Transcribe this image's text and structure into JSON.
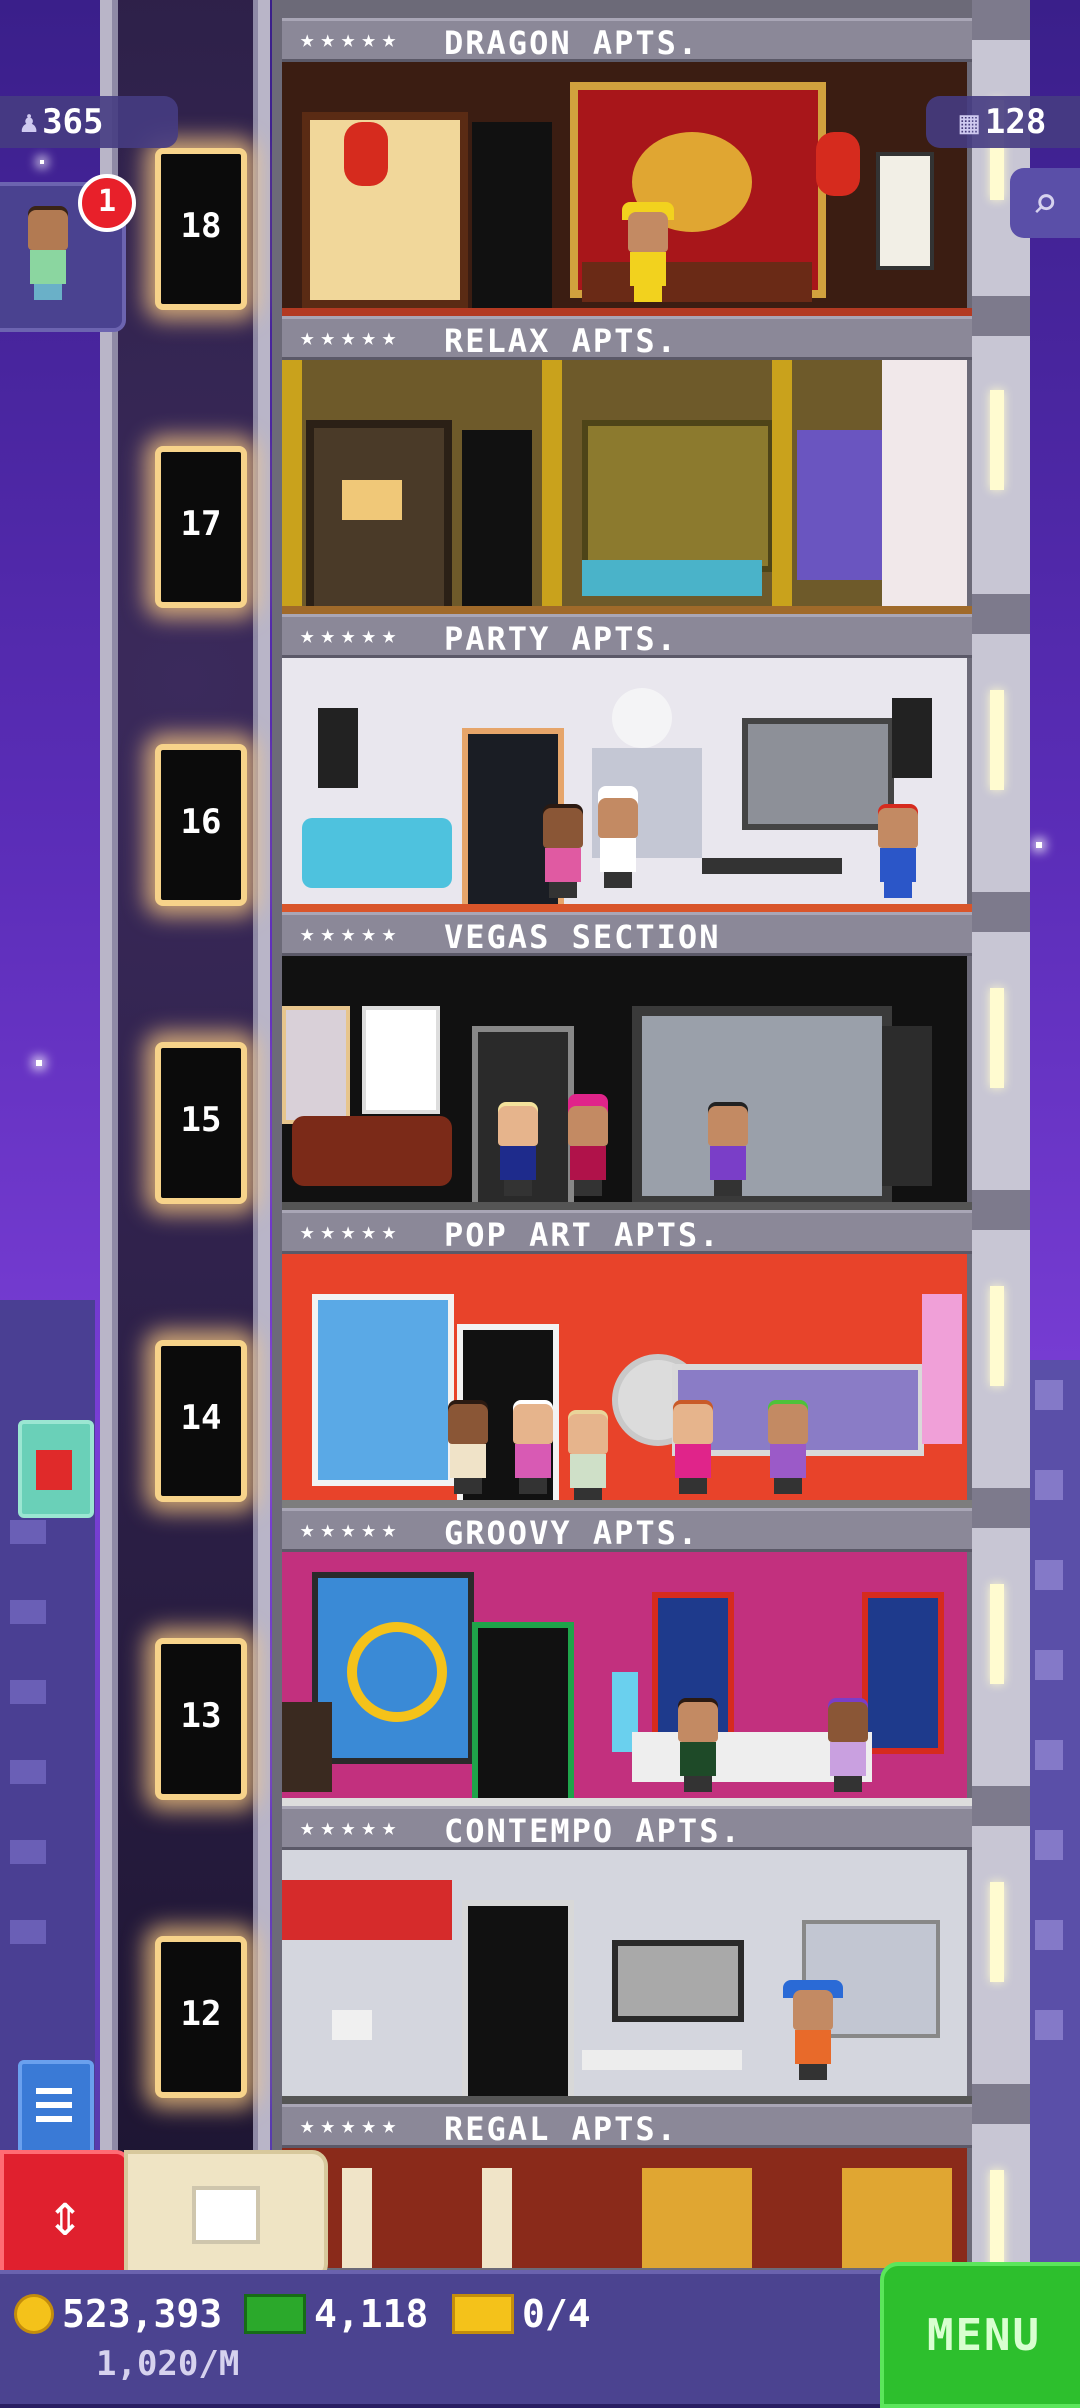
{
  "hud": {
    "population": "365",
    "floors_count": "128",
    "notification_count": "1"
  },
  "floors": [
    {
      "number": "18",
      "name": "DRAGON APTS.",
      "stars": "★★★★★"
    },
    {
      "number": "17",
      "name": "RELAX APTS.",
      "stars": "★★★★★"
    },
    {
      "number": "16",
      "name": "PARTY APTS.",
      "stars": "★★★★★"
    },
    {
      "number": "15",
      "name": "VEGAS SECTION",
      "stars": "★★★★★"
    },
    {
      "number": "14",
      "name": "POP ART APTS.",
      "stars": "★★★★★"
    },
    {
      "number": "13",
      "name": "GROOVY APTS.",
      "stars": "★★★★★"
    },
    {
      "number": "12",
      "name": "CONTEMPO APTS.",
      "stars": "★★★★★"
    },
    {
      "number": "",
      "name": "REGAL APTS.",
      "stars": "★★★★★"
    }
  ],
  "bottom": {
    "coins": "523,393",
    "bux": "4,118",
    "tickets": "0/4",
    "rate": "1,020/M",
    "menu_label": "MENU"
  },
  "icons": {
    "population": "person-icon",
    "floors": "floors-grid-icon",
    "search": "magnifier-icon",
    "elevator": "elevator-arrows-icon",
    "build": "build-box-icon"
  },
  "colors": {
    "menu": "#2dbf2d",
    "elevator_button": "#e0202e",
    "notification": "#e8202a"
  }
}
